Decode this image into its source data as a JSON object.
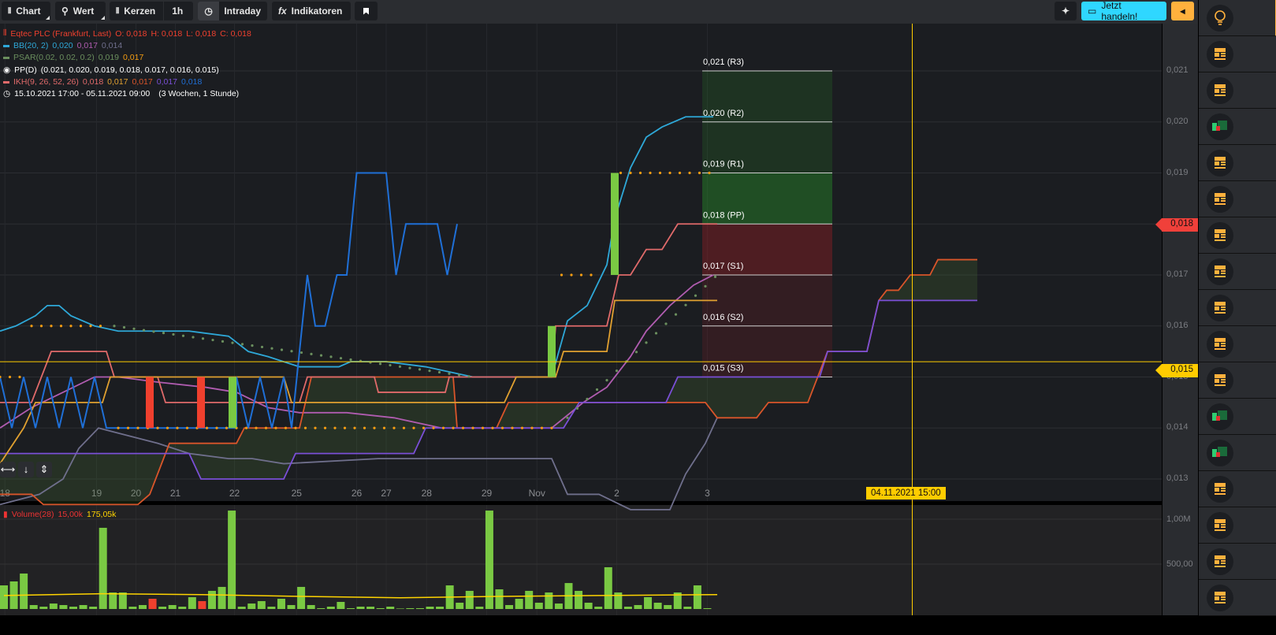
{
  "toolbar": {
    "chart": "Chart",
    "wert": "Wert",
    "kerzen": "Kerzen",
    "interval": "1h",
    "intraday": "Intraday",
    "indikatoren": "Indikatoren",
    "trade": "Jetzt handeln!"
  },
  "legend": {
    "instrument": "Eqtec PLC (Frankfurt, Last)",
    "o": "O: 0,018",
    "h": "H: 0,018",
    "l": "L: 0,018",
    "c": "C: 0,018",
    "bb": "BB(20, 2)",
    "bb_v": [
      "0,020",
      "0,017",
      "0,014"
    ],
    "psar": "PSAR(0.02, 0.02, 0.2)",
    "psar_v": [
      "0,019",
      "0,017"
    ],
    "pp": "PP(D)",
    "pp_v": "(0.021, 0.020, 0.019, 0.018, 0.017, 0.016, 0.015)",
    "ikh": "IKH(9, 26, 52, 26)",
    "ikh_v": [
      "0,018",
      "0,017",
      "0,017",
      "0,017",
      "0,018"
    ],
    "range": "15.10.2021 17:00 - 05.11.2021 09:00",
    "range_info": "(3 Wochen, 1 Stunde)",
    "volume": "Volume(28)",
    "volume_v": [
      "15,00k",
      "175,05k"
    ]
  },
  "axis": {
    "price_ticks": [
      "0,021",
      "0,020",
      "0,019",
      "0,018",
      "0,017",
      "0,016",
      "0,015",
      "0,014",
      "0,013"
    ],
    "volume_ticks": [
      "1,00M",
      "500,00"
    ],
    "last_badge": "0,018",
    "current_badge": "0,015",
    "crosshair_label": "04.11.2021 15:00"
  },
  "colors": {
    "bb_upper": "#2ea8d8",
    "bb_mid": "#b05cb0",
    "bb_lower": "#6f6f8c",
    "close": "#1f6fd6",
    "tenkan": "#e06a6a",
    "kijun": "#e0a030",
    "senkou_a": "#d9552a",
    "senkou_b": "#7a4fd6",
    "up": "#7ac943",
    "down": "#f0402e",
    "accent": "#ffb13d",
    "trade": "#2fd7ff"
  },
  "chart_data": {
    "type": "line",
    "title": "Eqtec PLC (Frankfurt, Last)",
    "ylim": [
      0.0125,
      0.0214
    ],
    "price_ticks": [
      0.021,
      0.02,
      0.019,
      0.018,
      0.017,
      0.016,
      0.015,
      0.014,
      0.013
    ],
    "x_ticks": [
      [
        "18",
        0.5
      ],
      [
        "19",
        9.8
      ],
      [
        "20",
        13.8
      ],
      [
        "21",
        17.8
      ],
      [
        "22",
        23.8
      ],
      [
        "25",
        30.1
      ],
      [
        "26",
        36.2
      ],
      [
        "27",
        39.2
      ],
      [
        "28",
        43.3
      ],
      [
        "29",
        49.4
      ],
      [
        "Nov",
        54.5
      ],
      [
        "2",
        62.6
      ],
      [
        "3",
        71.8
      ]
    ],
    "pivots": [
      [
        "0,021 (R3)",
        0.021
      ],
      [
        "0,020 (R2)",
        0.02
      ],
      [
        "0,019 (R1)",
        0.019
      ],
      [
        "0,018 (PP)",
        0.018
      ],
      [
        "0,017 (S1)",
        0.017
      ],
      [
        "0,016 (S2)",
        0.016
      ],
      [
        "0,015 (S3)",
        0.015
      ]
    ],
    "last_price": 0.018,
    "current_price": 0.0153,
    "crosshair_index": 92.6,
    "series": [
      {
        "name": "bb-upper",
        "color": "bb_upper",
        "points": [
          [
            0,
            0.0159
          ],
          [
            1.6,
            0.016
          ],
          [
            3.6,
            0.0162
          ],
          [
            4.8,
            0.0164
          ],
          [
            6,
            0.0164
          ],
          [
            7.2,
            0.0162
          ],
          [
            9.6,
            0.016
          ],
          [
            12,
            0.0159
          ],
          [
            16,
            0.0159
          ],
          [
            19.2,
            0.0159
          ],
          [
            23.2,
            0.0158
          ],
          [
            25.2,
            0.0155
          ],
          [
            27.2,
            0.0154
          ],
          [
            30.4,
            0.0152
          ],
          [
            34.4,
            0.0152
          ],
          [
            35.6,
            0.0153
          ],
          [
            37.6,
            0.0153
          ],
          [
            39.2,
            0.0153
          ],
          [
            43.2,
            0.0152
          ],
          [
            45.6,
            0.0151
          ],
          [
            48,
            0.015
          ],
          [
            56,
            0.015
          ],
          [
            57.6,
            0.0161
          ],
          [
            59.6,
            0.0164
          ],
          [
            61.6,
            0.0172
          ],
          [
            62.4,
            0.0181
          ],
          [
            64,
            0.0191
          ],
          [
            65.6,
            0.0197
          ],
          [
            67.2,
            0.0199
          ],
          [
            69.6,
            0.0201
          ],
          [
            72.4,
            0.0201
          ]
        ]
      },
      {
        "name": "bb-mid",
        "color": "bb_mid",
        "points": [
          [
            0,
            0.014
          ],
          [
            3.2,
            0.0144
          ],
          [
            6.4,
            0.0147
          ],
          [
            9.6,
            0.015
          ],
          [
            12,
            0.015
          ],
          [
            16,
            0.0149
          ],
          [
            20.8,
            0.0148
          ],
          [
            24,
            0.0147
          ],
          [
            27.2,
            0.0144
          ],
          [
            30.4,
            0.0143
          ],
          [
            35.2,
            0.0143
          ],
          [
            40,
            0.0142
          ],
          [
            44.8,
            0.014
          ],
          [
            56,
            0.014
          ],
          [
            59.2,
            0.0145
          ],
          [
            61.6,
            0.0148
          ],
          [
            64,
            0.0154
          ],
          [
            65.6,
            0.0159
          ],
          [
            68,
            0.0164
          ],
          [
            70.4,
            0.0168
          ],
          [
            72.4,
            0.017
          ]
        ]
      },
      {
        "name": "bb-lower",
        "color": "bb_lower",
        "points": [
          [
            0,
            0.0125
          ],
          [
            4,
            0.0127
          ],
          [
            6.4,
            0.013
          ],
          [
            8,
            0.0136
          ],
          [
            10,
            0.014
          ],
          [
            12,
            0.0139
          ],
          [
            16,
            0.0137
          ],
          [
            19.2,
            0.0135
          ],
          [
            23.2,
            0.0134
          ],
          [
            25.6,
            0.0134
          ],
          [
            28.8,
            0.0133
          ],
          [
            38.4,
            0.0134
          ],
          [
            44.8,
            0.0134
          ],
          [
            56,
            0.0134
          ],
          [
            57.6,
            0.0127
          ],
          [
            60.8,
            0.0127
          ],
          [
            64,
            0.0124
          ],
          [
            68,
            0.0124
          ],
          [
            69.6,
            0.0131
          ],
          [
            71.6,
            0.0137
          ],
          [
            72.8,
            0.0142
          ]
        ]
      },
      {
        "name": "senkou-a",
        "color": "senkou_a",
        "points": [
          [
            0,
            0.0127
          ],
          [
            3.2,
            0.0127
          ],
          [
            4.4,
            0.0125
          ],
          [
            14,
            0.0125
          ],
          [
            15.2,
            0.0127
          ],
          [
            16.8,
            0.0135
          ],
          [
            17.2,
            0.0137
          ],
          [
            24,
            0.0137
          ],
          [
            24.8,
            0.014
          ],
          [
            30.4,
            0.014
          ],
          [
            31.6,
            0.015
          ],
          [
            46,
            0.015
          ],
          [
            46.4,
            0.014
          ],
          [
            50.4,
            0.014
          ],
          [
            51.6,
            0.0145
          ],
          [
            71.6,
            0.0145
          ],
          [
            72.8,
            0.0142
          ],
          [
            76.8,
            0.0142
          ],
          [
            78,
            0.0145
          ],
          [
            82,
            0.0145
          ],
          [
            84,
            0.0155
          ],
          [
            88,
            0.0155
          ],
          [
            89.2,
            0.0165
          ],
          [
            90,
            0.0167
          ],
          [
            91.2,
            0.0167
          ],
          [
            92.4,
            0.017
          ],
          [
            94.4,
            0.017
          ],
          [
            95.2,
            0.0173
          ],
          [
            99.2,
            0.0173
          ]
        ]
      },
      {
        "name": "senkou-b",
        "color": "senkou_b",
        "points": [
          [
            0,
            0.0135
          ],
          [
            19.2,
            0.0135
          ],
          [
            20.4,
            0.013
          ],
          [
            28.8,
            0.013
          ],
          [
            30,
            0.0135
          ],
          [
            42,
            0.0135
          ],
          [
            43.2,
            0.014
          ],
          [
            57.2,
            0.014
          ],
          [
            58.8,
            0.0145
          ],
          [
            67.6,
            0.0145
          ],
          [
            68.8,
            0.015
          ],
          [
            83.2,
            0.015
          ],
          [
            84,
            0.0155
          ],
          [
            88,
            0.0155
          ],
          [
            89.2,
            0.0165
          ],
          [
            99.2,
            0.0165
          ]
        ]
      },
      {
        "name": "tenkan",
        "color": "tenkan",
        "points": [
          [
            0,
            0.0145
          ],
          [
            3.2,
            0.0145
          ],
          [
            5.2,
            0.0155
          ],
          [
            10.8,
            0.0155
          ],
          [
            11.6,
            0.015
          ],
          [
            16,
            0.015
          ],
          [
            16.8,
            0.0145
          ],
          [
            30.4,
            0.0145
          ],
          [
            31.2,
            0.015
          ],
          [
            38,
            0.015
          ],
          [
            38.4,
            0.0147
          ],
          [
            45.2,
            0.0147
          ],
          [
            45.6,
            0.015
          ],
          [
            56,
            0.015
          ],
          [
            56.4,
            0.016
          ],
          [
            61.6,
            0.016
          ],
          [
            62.8,
            0.017
          ],
          [
            64,
            0.017
          ],
          [
            65.6,
            0.0175
          ],
          [
            67.2,
            0.0175
          ],
          [
            68.8,
            0.018
          ],
          [
            72.8,
            0.018
          ]
        ]
      },
      {
        "name": "kijun",
        "color": "kijun",
        "points": [
          [
            0,
            0.0133
          ],
          [
            2.4,
            0.014
          ],
          [
            3.6,
            0.0145
          ],
          [
            10.4,
            0.0145
          ],
          [
            11.2,
            0.015
          ],
          [
            28.8,
            0.015
          ],
          [
            29.6,
            0.0145
          ],
          [
            51.2,
            0.0145
          ],
          [
            52.4,
            0.015
          ],
          [
            56.4,
            0.015
          ],
          [
            57.2,
            0.0155
          ],
          [
            61.6,
            0.0155
          ],
          [
            62.4,
            0.0165
          ],
          [
            72.8,
            0.0165
          ]
        ]
      },
      {
        "name": "close-line",
        "color": "close",
        "points": [
          [
            0,
            0.015
          ],
          [
            1.2,
            0.014
          ],
          [
            2.4,
            0.015
          ],
          [
            3.6,
            0.014
          ],
          [
            4.8,
            0.015
          ],
          [
            6,
            0.014
          ],
          [
            7.2,
            0.015
          ],
          [
            8.4,
            0.014
          ],
          [
            9.6,
            0.015
          ],
          [
            10.8,
            0.014
          ],
          [
            24,
            0.014
          ],
          [
            24,
            0.015
          ],
          [
            25.2,
            0.014
          ],
          [
            26.4,
            0.015
          ],
          [
            27.6,
            0.014
          ],
          [
            28.8,
            0.015
          ],
          [
            29.6,
            0.014
          ],
          [
            31.2,
            0.017
          ],
          [
            32,
            0.016
          ],
          [
            33,
            0.016
          ],
          [
            34.2,
            0.017
          ],
          [
            35.2,
            0.017
          ],
          [
            36.2,
            0.019
          ],
          [
            39.2,
            0.019
          ],
          [
            40.2,
            0.017
          ],
          [
            41.2,
            0.018
          ],
          [
            44.4,
            0.018
          ],
          [
            45.4,
            0.017
          ],
          [
            46.4,
            0.018
          ]
        ]
      }
    ],
    "psar": [
      {
        "from": 0,
        "to": 2.4,
        "start": 0.015,
        "end": 0.015,
        "color": "#f39c12"
      },
      {
        "from": 3.2,
        "to": 10.4,
        "start": 0.016,
        "end": 0.016,
        "color": "#f39c12"
      },
      {
        "from": 11.6,
        "to": 48,
        "start": 0.016,
        "end": 0.015,
        "color": "#6b8f5e"
      },
      {
        "from": 12,
        "to": 56,
        "start": 0.014,
        "end": 0.014,
        "color": "#f39c12"
      },
      {
        "from": 57,
        "to": 60.5,
        "start": 0.017,
        "end": 0.017,
        "color": "#f39c12"
      },
      {
        "from": 57.6,
        "to": 72.8,
        "start": 0.0142,
        "end": 0.017,
        "color": "#6b8f5e"
      },
      {
        "from": 63,
        "to": 72.8,
        "start": 0.019,
        "end": 0.019,
        "color": "#f39c12"
      }
    ],
    "candles": [
      [
        15.2,
        0.015,
        0.014
      ],
      [
        20.4,
        0.015,
        0.014
      ],
      [
        23.6,
        0.014,
        0.015
      ],
      [
        56,
        0.015,
        0.016
      ],
      [
        62.4,
        0.017,
        0.019
      ]
    ],
    "volume": {
      "ylim": [
        0,
        1150
      ],
      "unit": "k",
      "values": [
        263,
        307,
        395,
        44,
        26,
        61,
        44,
        26,
        44,
        26,
        904,
        184,
        184,
        26,
        44,
        114,
        26,
        44,
        26,
        132,
        88,
        202,
        246,
        1096,
        26,
        61,
        88,
        26,
        114,
        44,
        246,
        44,
        9,
        26,
        79,
        9,
        26,
        26,
        9,
        26,
        5,
        9,
        9,
        26,
        26,
        263,
        70,
        202,
        26,
        1096,
        219,
        44,
        114,
        202,
        70,
        184,
        61,
        289,
        202,
        70,
        26,
        465,
        184,
        26,
        44,
        132,
        70,
        44,
        184,
        26,
        263,
        9
      ],
      "down_bars": [
        15,
        20
      ],
      "ma": [
        [
          0,
          150
        ],
        [
          10,
          170
        ],
        [
          20,
          160
        ],
        [
          30,
          140
        ],
        [
          40,
          125
        ],
        [
          50,
          140
        ],
        [
          60,
          150
        ],
        [
          72,
          160
        ]
      ]
    }
  },
  "sidebar": {
    "items": [
      "idea",
      "news",
      "news",
      "chart",
      "news",
      "news",
      "news",
      "news",
      "news",
      "news",
      "news",
      "chart",
      "chart",
      "news",
      "news",
      "news",
      "news"
    ]
  }
}
